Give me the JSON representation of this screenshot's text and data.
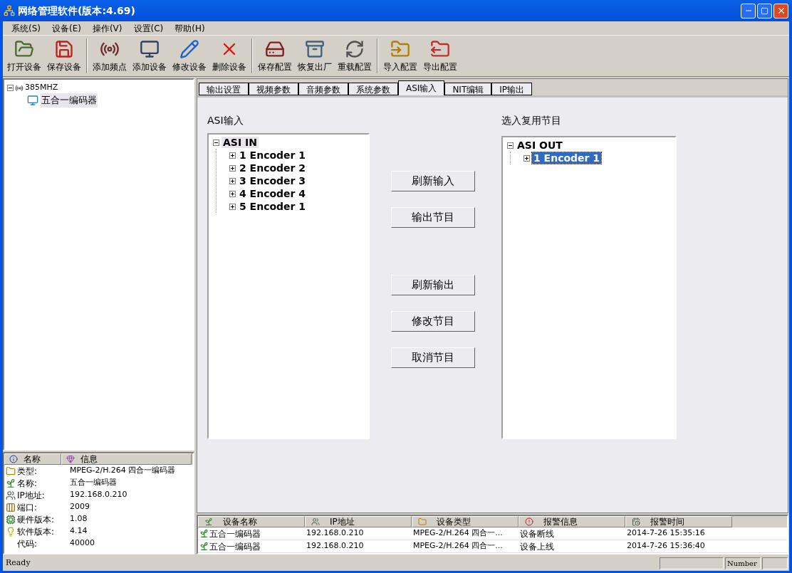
{
  "window": {
    "title": "网络管理软件(版本:4.69)"
  },
  "menu": [
    "系统(S)",
    "设备(E)",
    "操作(V)",
    "设置(C)",
    "帮助(H)"
  ],
  "toolbar": [
    [
      "打开设备",
      "保存设备"
    ],
    [
      "添加频点",
      "添加设备",
      "修改设备",
      "删除设备"
    ],
    [
      "保存配置",
      "恢复出厂",
      "重载配置"
    ],
    [
      "导入配置",
      "导出配置"
    ]
  ],
  "device_tree": [
    {
      "label": "385MHZ",
      "expanded": true,
      "selected": false,
      "children": [
        {
          "label": "五合一编码器",
          "selected": true
        }
      ]
    }
  ],
  "info_list": {
    "columns": [
      "名称",
      "信息"
    ],
    "rows": [
      {
        "kind": "type",
        "label": "类型:",
        "value": "MPEG-2/H.264 四合一编码器"
      },
      {
        "kind": "name",
        "label": "名称:",
        "value": "五合一编码器"
      },
      {
        "kind": "ip",
        "label": "IP地址:",
        "value": "192.168.0.210"
      },
      {
        "kind": "port",
        "label": "端口:",
        "value": "2009"
      },
      {
        "kind": "hardware",
        "label": "硬件版本:",
        "value": "1.08"
      },
      {
        "kind": "software",
        "label": "软件版本:",
        "value": "4.14"
      },
      {
        "kind": "code",
        "label": "代码:",
        "value": "40000"
      }
    ]
  },
  "tabs": [
    {
      "label": "输出设置",
      "selected": false
    },
    {
      "label": "视频参数",
      "selected": false
    },
    {
      "label": "音频参数",
      "selected": false
    },
    {
      "label": "系统参数",
      "selected": false
    },
    {
      "label": "ASI输入",
      "selected": true
    },
    {
      "label": "NIT编辑",
      "selected": false
    },
    {
      "label": "IP输出",
      "selected": false
    }
  ],
  "input_panel": {
    "title": "ASI输入",
    "focused": false,
    "tree": {
      "label": "ASI IN",
      "expanded": true,
      "selected": true,
      "children": [
        {
          "label": "1 Encoder 1",
          "expanded": false,
          "selected": false
        },
        {
          "label": "2 Encoder 2",
          "expanded": false,
          "selected": false
        },
        {
          "label": "3 Encoder 3",
          "expanded": false,
          "selected": false
        },
        {
          "label": "4 Encoder 4",
          "expanded": false,
          "selected": false
        },
        {
          "label": "5 Encoder 1",
          "expanded": false,
          "selected": false
        }
      ]
    }
  },
  "button_groups": [
    [
      "刷新输入",
      "输出节目"
    ],
    [
      "刷新输出",
      "修改节目",
      "取消节目"
    ]
  ],
  "output_panel": {
    "title": "选入复用节目",
    "focused": true,
    "tree": {
      "label": "ASI OUT",
      "expanded": true,
      "selected": false,
      "children": [
        {
          "label": "1 Encoder 1",
          "expanded": false,
          "selected": true
        }
      ]
    }
  },
  "alarm_table": {
    "columns": [
      "设备名称",
      "IP地址",
      "设备类型",
      "报警信息",
      "报警时间"
    ],
    "rows": [
      [
        "五合一编码器",
        "192.168.0.210",
        "MPEG-2/H.264 四合一...",
        "设备断线",
        "2014-7-26 15:35:16"
      ],
      [
        "五合一编码器",
        "192.168.0.210",
        "MPEG-2/H.264 四合一...",
        "设备上线",
        "2014-7-26 15:36:40"
      ]
    ]
  },
  "status_bar": {
    "text": "Ready",
    "indicator": "Number"
  }
}
